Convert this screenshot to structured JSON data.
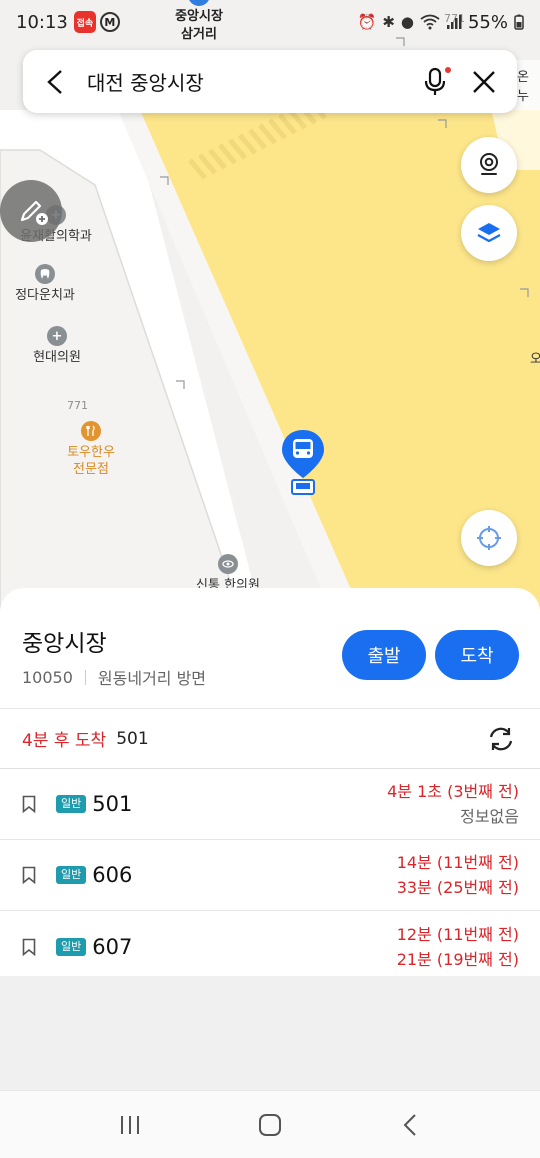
{
  "status": {
    "time": "10:13",
    "app_badge": "접속",
    "app2": "M",
    "battery": "55%"
  },
  "map": {
    "top_label": "중앙시장\n삼거리",
    "road_label_top": "771",
    "road_label": "771",
    "edge_right_1": "온누",
    "edge_right_2": "오",
    "pois": [
      {
        "name": "윤재활의학과",
        "icon": "plus-icon"
      },
      {
        "name": "정다운치과",
        "icon": "tooth-icon"
      },
      {
        "name": "현대의원",
        "icon": "plus-icon"
      },
      {
        "name": "토우한우\n전문점",
        "icon": "fork-knife-icon"
      },
      {
        "name": "신통 한의원",
        "icon": "eye-icon"
      }
    ],
    "colors": {
      "zone": "#fde68a",
      "road": "#ffffff",
      "marker": "#1a6ff0"
    }
  },
  "search": {
    "query": "대전 중앙시장"
  },
  "sheet": {
    "stop_name": "중앙시장",
    "stop_id": "10050",
    "direction": "원동네거리 방면",
    "depart_label": "출발",
    "arrive_label": "도착",
    "arrival_summary": {
      "when": "4분 후 도착",
      "bus": "501"
    },
    "routes": [
      {
        "type": "일반",
        "number": "501",
        "times": [
          "4분 1초 (3번째 전)",
          "정보없음"
        ],
        "second_grey": true
      },
      {
        "type": "일반",
        "number": "606",
        "times": [
          "14분 (11번째 전)",
          "33분 (25번째 전)"
        ],
        "second_grey": false
      },
      {
        "type": "일반",
        "number": "607",
        "times": [
          "12분 (11번째 전)",
          "21분 (19번째 전)"
        ],
        "second_grey": false
      }
    ]
  }
}
